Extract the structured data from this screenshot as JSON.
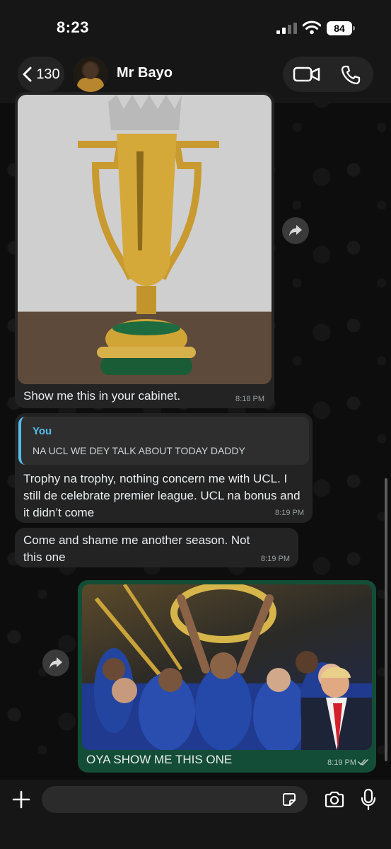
{
  "status_bar": {
    "time": "8:23",
    "battery": "84"
  },
  "header": {
    "back_count": "130",
    "contact_name": "Mr Bayo"
  },
  "messages": [
    {
      "type": "image",
      "direction": "incoming",
      "image": "premier-league-trophy-photo",
      "caption": "Show me this in your cabinet.",
      "time": "8:18 PM"
    },
    {
      "type": "reply",
      "direction": "incoming",
      "quoted_author": "You",
      "quoted_text": "NA UCL WE DEY TALK ABOUT TODAY DADDY",
      "text": "Trophy na trophy, nothing concern me with UCL. I still de celebrate premier league. UCL na bonus and it didn’t come",
      "time": "8:19 PM"
    },
    {
      "type": "text",
      "direction": "incoming",
      "text": "Come and shame me another season. Not this one",
      "time": "8:19 PM"
    },
    {
      "type": "image",
      "direction": "outgoing",
      "image": "trophy-celebration-photo",
      "caption": "OYA SHOW ME THIS ONE",
      "time": "8:19 PM",
      "status": "read"
    }
  ],
  "composer": {
    "placeholder": ""
  },
  "colors": {
    "incoming_bubble": "#232323",
    "outgoing_bubble": "#144d37",
    "quote_accent": "#53bdeb",
    "background": "#0b0b0b"
  },
  "icons": [
    "chevron-left-icon",
    "video-camera-icon",
    "phone-icon",
    "forward-icon",
    "plus-icon",
    "sticker-icon",
    "camera-icon",
    "microphone-icon",
    "double-check-icon"
  ]
}
